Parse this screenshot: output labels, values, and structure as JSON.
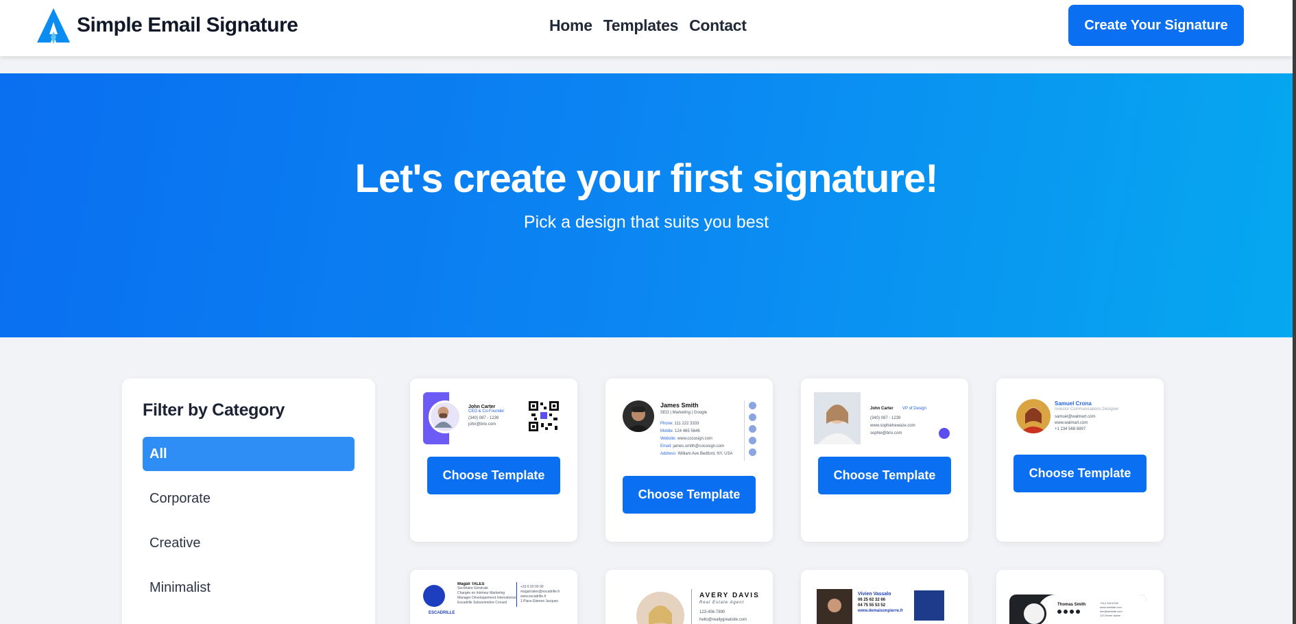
{
  "header": {
    "brand_name": "Simple Email Signature",
    "nav": [
      "Home",
      "Templates",
      "Contact"
    ],
    "cta_label": "Create Your Signature"
  },
  "hero": {
    "title": "Let's create your first signature!",
    "subtitle": "Pick a design that suits you best"
  },
  "filter": {
    "title": "Filter by Category",
    "categories": [
      "All",
      "Corporate",
      "Creative",
      "Minimalist"
    ],
    "selected": "All"
  },
  "templates": {
    "choose_label": "Choose Template",
    "cards": [
      {
        "name": "John Carter",
        "role": "CEO & Co-Founder",
        "lines": [
          "(340) 087 - 1239",
          "john@brix.com"
        ]
      },
      {
        "name": "James Smith",
        "role": "SEO | Marketing | Google",
        "lines": [
          {
            "k": "Phone:",
            "v": "111 222 3333"
          },
          {
            "k": "Mobile:",
            "v": "124 465 5646"
          },
          {
            "k": "Website:",
            "v": "www.cocosign.com"
          },
          {
            "k": "Email:",
            "v": "james.smith@cocosign.com"
          },
          {
            "k": "Address:",
            "v": "William Ave Bedford, NY, USA"
          }
        ]
      },
      {
        "name": "John Carter",
        "role": "VP of Design",
        "lines": [
          "(340) 087 - 1239",
          "www.sophiehewaze.com",
          "sophie@brix.com"
        ]
      },
      {
        "name": "Samuel Crona",
        "role": "Investor Communications Designer",
        "lines": [
          "samuel@walmart.com",
          "www.walmart.com",
          "+1 234 568 8897"
        ]
      },
      {
        "name": "Magali TALÈS",
        "role": "Secrétaire Générale",
        "lines": [
          "Chargée en Intérieur Marketing",
          "Manager Développement International",
          "Escadrille Subsonimètre Conseil"
        ],
        "right_lines": [
          "+33 6 00 00 00",
          "magali.tales@escadrille.fr",
          "www.escadrille.fr",
          "1 Place Etienne Jacques"
        ],
        "brand": "ESCADRILLE"
      },
      {
        "name": "AVERY DAVIS",
        "role": "Real Estate Agent",
        "lines": [
          "123-456-7890",
          "hello@reallygreatsite.com"
        ]
      },
      {
        "name": "Vivien Vassalo",
        "role": "",
        "lines": [
          "06 25 62 32 66",
          "04 75 55 53 52",
          "www.demaisonpierre.fr"
        ]
      },
      {
        "name": "Thomas Smith",
        "role": "",
        "lines": [
          "+012 345 6789",
          "www.website.com",
          "info@website.com",
          "123 Street Name"
        ]
      }
    ]
  },
  "colors": {
    "primary": "#0a6ff0",
    "hero_gradient_start": "#0a6ff0",
    "hero_gradient_end": "#06a8f0",
    "filter_active": "#2f8ef5",
    "page_bg": "#f1f3f6"
  }
}
